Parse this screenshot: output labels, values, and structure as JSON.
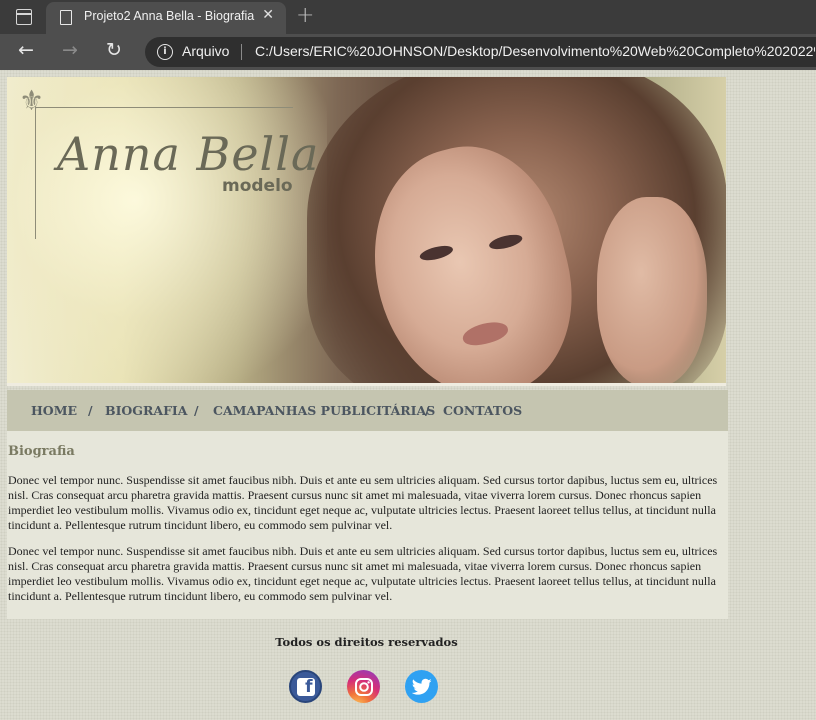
{
  "browser": {
    "tab_title": "Projeto2 Anna Bella - Biografia",
    "tab_close": "✕",
    "new_tab": "+",
    "address_label": "Arquivo",
    "address_url": "C:/Users/ERIC%20JOHNSON/Desktop/Desenvolvimento%20Web%20Completo%202022%2"
  },
  "banner": {
    "brand": "Anna Bella",
    "brand_sub": "modelo"
  },
  "nav": {
    "items": [
      "HOME",
      "BIOGRAFIA",
      "CAMAPANHAS PUBLICITÁRIAS",
      "CONTATOS"
    ],
    "separator": "/"
  },
  "content": {
    "title": "Biografia",
    "paragraphs": [
      "Donec vel tempor nunc. Suspendisse sit amet faucibus nibh. Duis et ante eu sem ultricies aliquam. Sed cursus tortor dapibus, luctus sem eu, ultrices nisl. Cras consequat arcu pharetra gravida mattis. Praesent cursus nunc sit amet mi malesuada, vitae viverra lorem cursus. Donec rhoncus sapien imperdiet leo vestibulum mollis. Vivamus odio ex, tincidunt eget neque ac, vulputate ultricies lectus. Praesent laoreet tellus tellus, at tincidunt nulla tincidunt a. Pellentesque rutrum tincidunt libero, eu commodo sem pulvinar vel.",
      "Donec vel tempor nunc. Suspendisse sit amet faucibus nibh. Duis et ante eu sem ultricies aliquam. Sed cursus tortor dapibus, luctus sem eu, ultrices nisl. Cras consequat arcu pharetra gravida mattis. Praesent cursus nunc sit amet mi malesuada, vitae viverra lorem cursus. Donec rhoncus sapien imperdiet leo vestibulum mollis. Vivamus odio ex, tincidunt eget neque ac, vulputate ultricies lectus. Praesent laoreet tellus tellus, at tincidunt nulla tincidunt a. Pellentesque rutrum tincidunt libero, eu commodo sem pulvinar vel."
    ]
  },
  "footer": {
    "rights": "Todos os direitos reservados",
    "social": [
      "facebook-icon",
      "instagram-icon",
      "twitter-icon"
    ]
  },
  "colors": {
    "nav_bg": "#c5c5b0",
    "content_bg": "#e6e6da",
    "nav_text": "#4c5660",
    "facebook": "#3b5a99",
    "twitter": "#2fa1f2"
  }
}
